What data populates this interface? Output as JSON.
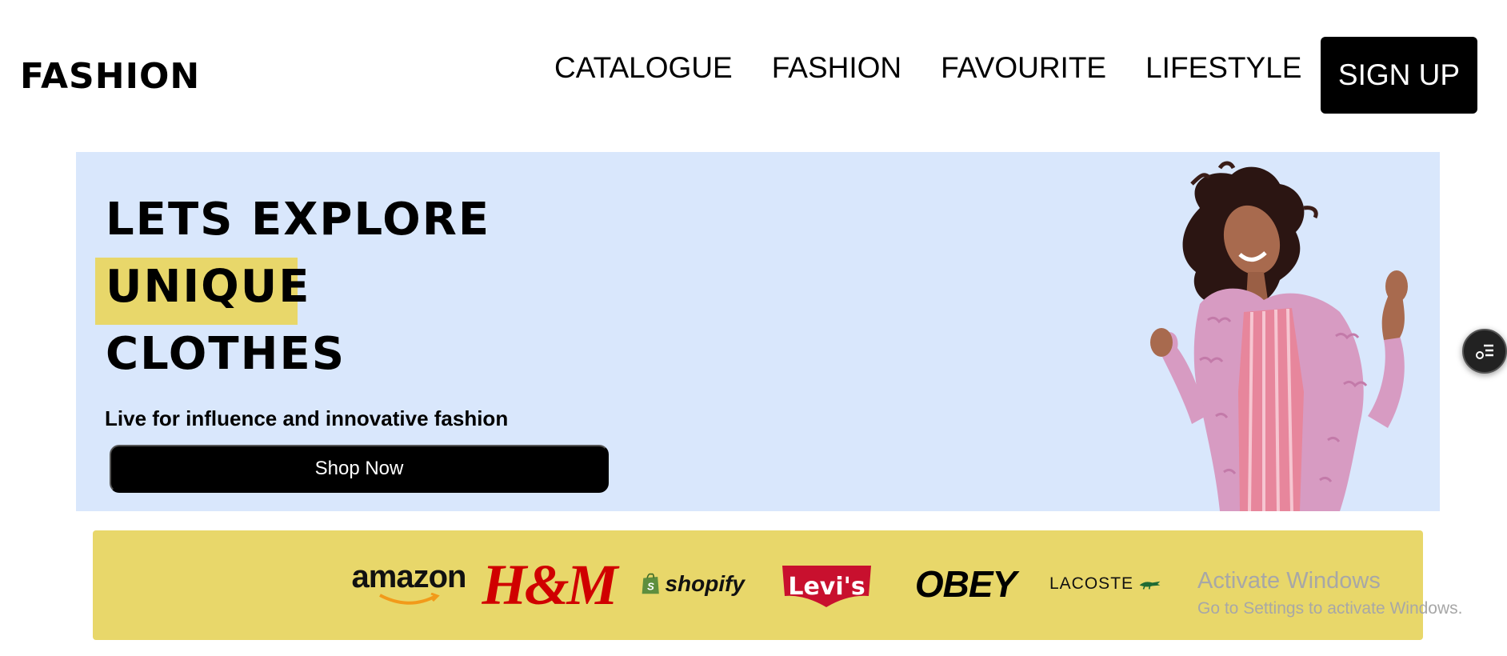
{
  "header": {
    "logo": "FASHION",
    "nav": [
      "CATALOGUE",
      "FASHION",
      "FAVOURITE",
      "LIFESTYLE"
    ],
    "signup_label": "SIGN UP"
  },
  "hero": {
    "line1": "LETS EXPLORE",
    "line2": "UNIQUE",
    "line3": "CLOTHES",
    "tagline": "Live for influence and innovative fashion",
    "cta_label": "Shop Now",
    "image": "woman-in-pink-fur-coat",
    "bg_color": "#d9e7fc",
    "highlight_color": "#e8d76a"
  },
  "brands": {
    "bg_color": "#e8d76a",
    "items": [
      "amazon",
      "H&M",
      "shopify",
      "Levi's",
      "OBEY",
      "LACOSTE"
    ]
  },
  "side_widget": {
    "icon": "list-settings-icon"
  },
  "watermark": {
    "title": "Activate Windows",
    "subtitle": "Go to Settings to activate Windows."
  }
}
